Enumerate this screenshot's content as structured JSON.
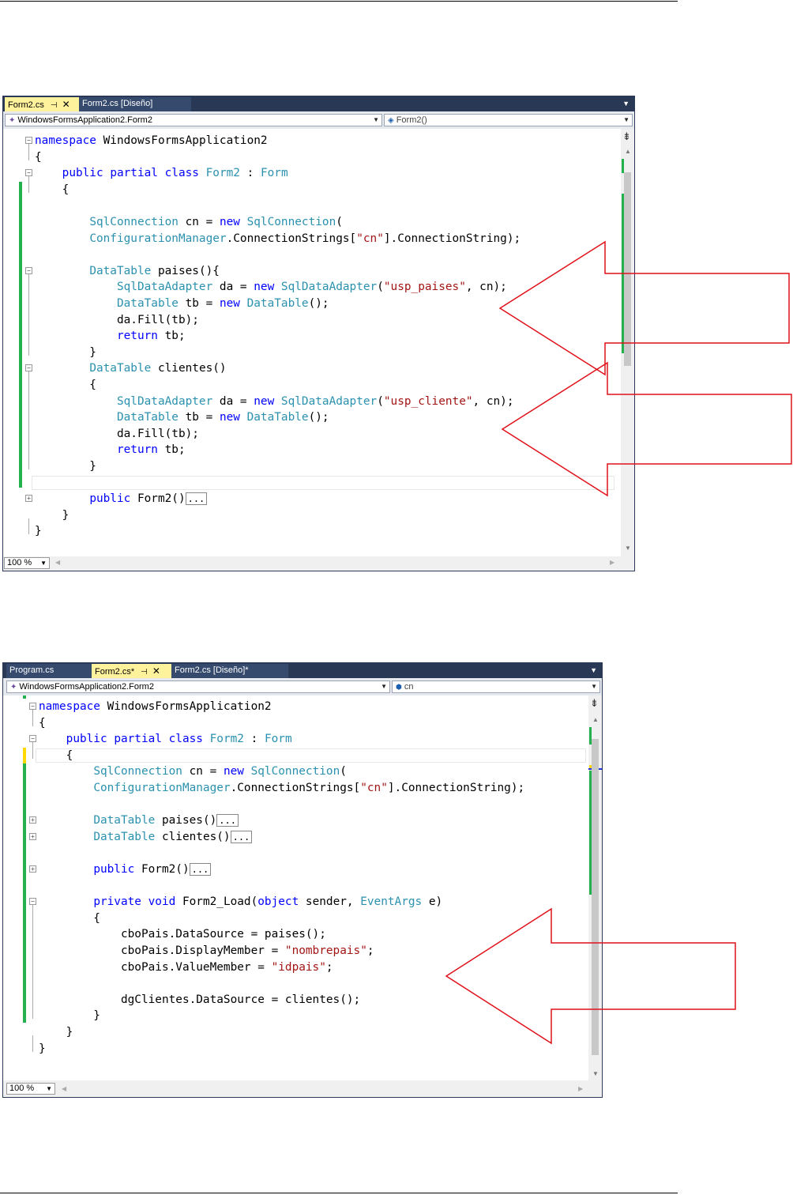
{
  "screen1": {
    "tabs": [
      {
        "label": "Form2.cs",
        "active": true,
        "pin": "⊣",
        "close": "✕"
      },
      {
        "label": "Form2.cs [Diseño]",
        "active": false
      }
    ],
    "nav_left": "WindowsFormsApplication2.Form2",
    "nav_right": "Form2()",
    "zoom": "100 %",
    "code": [
      [
        {
          "t": "namespace",
          "c": "kw"
        },
        {
          "t": " WindowsFormsApplication2"
        }
      ],
      [
        {
          "t": "{"
        }
      ],
      [
        {
          "t": "    "
        },
        {
          "t": "public",
          "c": "kw"
        },
        {
          "t": " "
        },
        {
          "t": "partial",
          "c": "kw"
        },
        {
          "t": " "
        },
        {
          "t": "class",
          "c": "kw"
        },
        {
          "t": " "
        },
        {
          "t": "Form2",
          "c": "ty"
        },
        {
          "t": " : "
        },
        {
          "t": "Form",
          "c": "ty"
        }
      ],
      [
        {
          "t": "    {"
        }
      ],
      [],
      [
        {
          "t": "        "
        },
        {
          "t": "SqlConnection",
          "c": "ty"
        },
        {
          "t": " cn = "
        },
        {
          "t": "new",
          "c": "kw"
        },
        {
          "t": " "
        },
        {
          "t": "SqlConnection",
          "c": "ty"
        },
        {
          "t": "("
        }
      ],
      [
        {
          "t": "        "
        },
        {
          "t": "ConfigurationManager",
          "c": "ty"
        },
        {
          "t": ".ConnectionStrings["
        },
        {
          "t": "\"cn\"",
          "c": "st"
        },
        {
          "t": "].ConnectionString);"
        }
      ],
      [],
      [
        {
          "t": "        "
        },
        {
          "t": "DataTable",
          "c": "ty"
        },
        {
          "t": " paises(){"
        }
      ],
      [
        {
          "t": "            "
        },
        {
          "t": "SqlDataAdapter",
          "c": "ty"
        },
        {
          "t": " da = "
        },
        {
          "t": "new",
          "c": "kw"
        },
        {
          "t": " "
        },
        {
          "t": "SqlDataAdapter",
          "c": "ty"
        },
        {
          "t": "("
        },
        {
          "t": "\"usp_paises\"",
          "c": "st"
        },
        {
          "t": ", cn);"
        }
      ],
      [
        {
          "t": "            "
        },
        {
          "t": "DataTable",
          "c": "ty"
        },
        {
          "t": " tb = "
        },
        {
          "t": "new",
          "c": "kw"
        },
        {
          "t": " "
        },
        {
          "t": "DataTable",
          "c": "ty"
        },
        {
          "t": "();"
        }
      ],
      [
        {
          "t": "            da.Fill(tb);"
        }
      ],
      [
        {
          "t": "            "
        },
        {
          "t": "return",
          "c": "kw"
        },
        {
          "t": " tb;"
        }
      ],
      [
        {
          "t": "        }"
        }
      ],
      [
        {
          "t": "        "
        },
        {
          "t": "DataTable",
          "c": "ty"
        },
        {
          "t": " clientes()"
        }
      ],
      [
        {
          "t": "        {"
        }
      ],
      [
        {
          "t": "            "
        },
        {
          "t": "SqlDataAdapter",
          "c": "ty"
        },
        {
          "t": " da = "
        },
        {
          "t": "new",
          "c": "kw"
        },
        {
          "t": " "
        },
        {
          "t": "SqlDataAdapter",
          "c": "ty"
        },
        {
          "t": "("
        },
        {
          "t": "\"usp_cliente\"",
          "c": "st"
        },
        {
          "t": ", cn);"
        }
      ],
      [
        {
          "t": "            "
        },
        {
          "t": "DataTable",
          "c": "ty"
        },
        {
          "t": " tb = "
        },
        {
          "t": "new",
          "c": "kw"
        },
        {
          "t": " "
        },
        {
          "t": "DataTable",
          "c": "ty"
        },
        {
          "t": "();"
        }
      ],
      [
        {
          "t": "            da.Fill(tb);"
        }
      ],
      [
        {
          "t": "            "
        },
        {
          "t": "return",
          "c": "kw"
        },
        {
          "t": " tb;"
        }
      ],
      [
        {
          "t": "        }"
        }
      ],
      [],
      [
        {
          "t": "        "
        },
        {
          "t": "public",
          "c": "kw"
        },
        {
          "t": " Form2()"
        },
        {
          "t": "...",
          "c": "ell"
        }
      ],
      [
        {
          "t": "    }"
        }
      ],
      [
        {
          "t": "}"
        }
      ]
    ]
  },
  "screen2": {
    "tabs": [
      {
        "label": "Program.cs",
        "active": false
      },
      {
        "label": "Form2.cs*",
        "active": true,
        "pin": "⊣",
        "close": "✕"
      },
      {
        "label": "Form2.cs [Diseño]*",
        "active": false
      }
    ],
    "nav_left": "WindowsFormsApplication2.Form2",
    "nav_right": "cn",
    "zoom": "100 %",
    "code": [
      [
        {
          "t": "namespace",
          "c": "kw"
        },
        {
          "t": " WindowsFormsApplication2"
        }
      ],
      [
        {
          "t": "{"
        }
      ],
      [
        {
          "t": "    "
        },
        {
          "t": "public",
          "c": "kw"
        },
        {
          "t": " "
        },
        {
          "t": "partial",
          "c": "kw"
        },
        {
          "t": " "
        },
        {
          "t": "class",
          "c": "kw"
        },
        {
          "t": " "
        },
        {
          "t": "Form2",
          "c": "ty"
        },
        {
          "t": " : "
        },
        {
          "t": "Form",
          "c": "ty"
        }
      ],
      [
        {
          "t": "    {"
        }
      ],
      [
        {
          "t": "        "
        },
        {
          "t": "SqlConnection",
          "c": "ty"
        },
        {
          "t": " cn = "
        },
        {
          "t": "new",
          "c": "kw"
        },
        {
          "t": " "
        },
        {
          "t": "SqlConnection",
          "c": "ty"
        },
        {
          "t": "("
        }
      ],
      [
        {
          "t": "        "
        },
        {
          "t": "ConfigurationManager",
          "c": "ty"
        },
        {
          "t": ".ConnectionStrings["
        },
        {
          "t": "\"cn\"",
          "c": "st"
        },
        {
          "t": "].ConnectionString);"
        }
      ],
      [],
      [
        {
          "t": "        "
        },
        {
          "t": "DataTable",
          "c": "ty"
        },
        {
          "t": " paises()"
        },
        {
          "t": "...",
          "c": "ell"
        }
      ],
      [
        {
          "t": "        "
        },
        {
          "t": "DataTable",
          "c": "ty"
        },
        {
          "t": " clientes()"
        },
        {
          "t": "...",
          "c": "ell"
        }
      ],
      [],
      [
        {
          "t": "        "
        },
        {
          "t": "public",
          "c": "kw"
        },
        {
          "t": " Form2()"
        },
        {
          "t": "...",
          "c": "ell"
        }
      ],
      [],
      [
        {
          "t": "        "
        },
        {
          "t": "private",
          "c": "kw"
        },
        {
          "t": " "
        },
        {
          "t": "void",
          "c": "kw"
        },
        {
          "t": " Form2_Load("
        },
        {
          "t": "object",
          "c": "kw"
        },
        {
          "t": " sender, "
        },
        {
          "t": "EventArgs",
          "c": "ty"
        },
        {
          "t": " e)"
        }
      ],
      [
        {
          "t": "        {"
        }
      ],
      [
        {
          "t": "            cboPais.DataSource = paises();"
        }
      ],
      [
        {
          "t": "            cboPais.DisplayMember = "
        },
        {
          "t": "\"nombrepais\"",
          "c": "st"
        },
        {
          "t": ";"
        }
      ],
      [
        {
          "t": "            cboPais.ValueMember = "
        },
        {
          "t": "\"idpais\"",
          "c": "st"
        },
        {
          "t": ";"
        }
      ],
      [],
      [
        {
          "t": "            dgClientes.DataSource = clientes();"
        }
      ],
      [
        {
          "t": "        }"
        }
      ],
      [
        {
          "t": "    }"
        }
      ],
      [
        {
          "t": "}"
        }
      ]
    ]
  },
  "colors": {
    "keyword": "#0000ff",
    "type": "#2b91af",
    "string": "#a31515",
    "arrow": "#e0101a",
    "changed": "#22b14c"
  }
}
